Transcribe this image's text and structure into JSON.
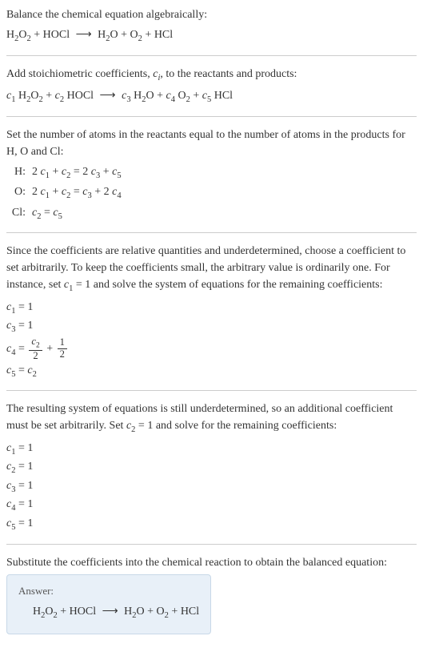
{
  "sections": {
    "intro": {
      "text": "Balance the chemical equation algebraically:",
      "equation": "H₂O₂ + HOCl ⟶ H₂O + O₂ + HCl"
    },
    "stoich": {
      "text_prefix": "Add stoichiometric coefficients, ",
      "text_var": "cᵢ",
      "text_suffix": ", to the reactants and products:",
      "equation": "c₁ H₂O₂ + c₂ HOCl ⟶ c₃ H₂O + c₄ O₂ + c₅ HCl"
    },
    "atoms": {
      "text": "Set the number of atoms in the reactants equal to the number of atoms in the products for H, O and Cl:",
      "rows": [
        {
          "label": "H:",
          "eq": "2 c₁ + c₂ = 2 c₃ + c₅"
        },
        {
          "label": "O:",
          "eq": "2 c₁ + c₂ = c₃ + 2 c₄"
        },
        {
          "label": "Cl:",
          "eq": "c₂ = c₅"
        }
      ]
    },
    "underdet1": {
      "text": "Since the coefficients are relative quantities and underdetermined, choose a coefficient to set arbitrarily. To keep the coefficients small, the arbitrary value is ordinarily one. For instance, set c₁ = 1 and solve the system of equations for the remaining coefficients:",
      "rows": [
        "c₁ = 1",
        "c₃ = 1",
        "__FRAC__",
        "c₅ = c₂"
      ],
      "frac_row": {
        "prefix": "c₄ = ",
        "f1_num": "c₂",
        "f1_den": "2",
        "plus": " + ",
        "f2_num": "1",
        "f2_den": "2"
      }
    },
    "underdet2": {
      "text": "The resulting system of equations is still underdetermined, so an additional coefficient must be set arbitrarily. Set c₂ = 1 and solve for the remaining coefficients:",
      "rows": [
        "c₁ = 1",
        "c₂ = 1",
        "c₃ = 1",
        "c₄ = 1",
        "c₅ = 1"
      ]
    },
    "substitute": {
      "text": "Substitute the coefficients into the chemical reaction to obtain the balanced equation:"
    },
    "answer": {
      "label": "Answer:",
      "equation": "H₂O₂ + HOCl ⟶ H₂O + O₂ + HCl"
    }
  },
  "chart_data": {
    "type": "table",
    "title": "Chemical equation balancing",
    "unbalanced_equation": "H2O2 + HOCl -> H2O + O2 + HCl",
    "elements": [
      "H",
      "O",
      "Cl"
    ],
    "atom_balance_equations": {
      "H": "2c1 + c2 = 2c3 + c5",
      "O": "2c1 + c2 = c3 + 2c4",
      "Cl": "c2 = c5"
    },
    "partial_solution": {
      "c1": 1,
      "c3": 1,
      "c4": "c2/2 + 1/2",
      "c5": "c2"
    },
    "final_coefficients": {
      "c1": 1,
      "c2": 1,
      "c3": 1,
      "c4": 1,
      "c5": 1
    },
    "balanced_equation": "H2O2 + HOCl -> H2O + O2 + HCl"
  }
}
